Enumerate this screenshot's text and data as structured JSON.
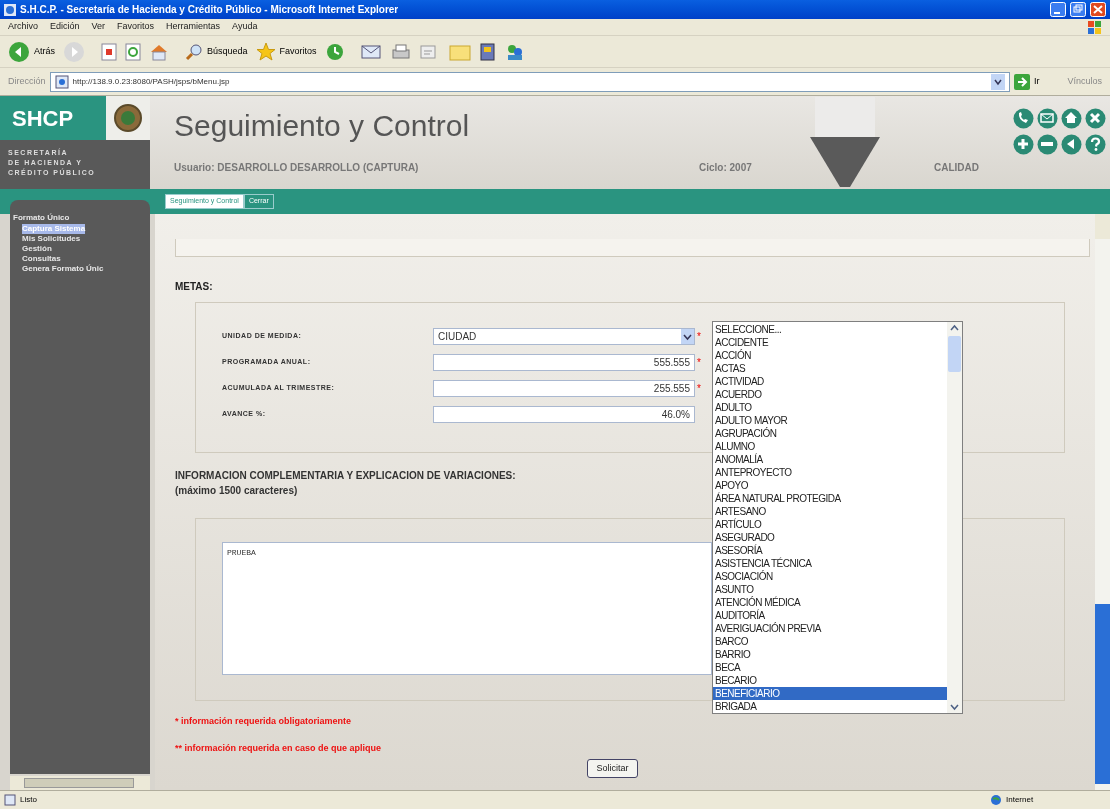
{
  "window": {
    "title": "S.H.C.P. - Secretaría de Hacienda y Crédito Público - Microsoft Internet Explorer"
  },
  "menu_bar": [
    "Archivo",
    "Edición",
    "Ver",
    "Favoritos",
    "Herramientas",
    "Ayuda"
  ],
  "toolbar": {
    "back": "Atrás",
    "search": "Búsqueda",
    "favorites": "Favoritos"
  },
  "address_bar": {
    "label": "Dirección",
    "url": "http://138.9.0.23:8080/PASH/jsps/bMenu.jsp",
    "go": "Ir",
    "links": "Vínculos"
  },
  "header": {
    "logo": "SHCP",
    "agency": [
      "SECRETARÍA",
      "DE HACIENDA Y",
      "CRÉDITO PÚBLICO"
    ],
    "title": "Seguimiento y Control",
    "user": "Usuario: DESARROLLO DESARROLLO (CAPTURA)",
    "cycle": "Ciclo: 2007",
    "area": "CALIDAD"
  },
  "tabs": [
    {
      "label": "Seguimiento y Control",
      "selected": true
    },
    {
      "label": "Cerrar",
      "selected": false
    }
  ],
  "sidebar": {
    "items": [
      {
        "label": "Formato Único",
        "selected": false,
        "children": [
          {
            "label": "Captura Sistema",
            "selected": true
          },
          {
            "label": "Mis Solicitudes",
            "selected": false
          },
          {
            "label": "Gestión",
            "selected": false
          },
          {
            "label": "Consultas",
            "selected": false
          },
          {
            "label": "Genera Formato Únic",
            "selected": false
          }
        ]
      }
    ]
  },
  "metas": {
    "heading": "METAS:",
    "fields": [
      {
        "label": "UNIDAD DE MEDIDA:",
        "kind": "select",
        "value": "CIUDAD",
        "required_mark": "*"
      },
      {
        "label": "PROGRAMADA ANUAL:",
        "kind": "text",
        "value": "555.555",
        "required_mark": "*"
      },
      {
        "label": "ACUMULADA AL TRIMESTRE:",
        "kind": "text",
        "value": "255.555",
        "required_mark": "*"
      },
      {
        "label": "AVANCE %:",
        "kind": "text",
        "value": "46.0%"
      }
    ]
  },
  "unit_list": {
    "options": [
      {
        "label": "SELECCIONE...",
        "selected": false
      },
      {
        "label": "ACCIDENTE",
        "selected": false
      },
      {
        "label": "ACCIÓN",
        "selected": false
      },
      {
        "label": "ACTAS",
        "selected": false
      },
      {
        "label": "ACTIVIDAD",
        "selected": false
      },
      {
        "label": "ACUERDO",
        "selected": false
      },
      {
        "label": "ADULTO",
        "selected": false
      },
      {
        "label": "ADULTO MAYOR",
        "selected": false
      },
      {
        "label": "AGRUPACIÓN",
        "selected": false
      },
      {
        "label": "ALUMNO",
        "selected": false
      },
      {
        "label": "ANOMALÍA",
        "selected": false
      },
      {
        "label": "ANTEPROYECTO",
        "selected": false
      },
      {
        "label": "APOYO",
        "selected": false
      },
      {
        "label": "ÁREA NATURAL PROTEGIDA",
        "selected": false
      },
      {
        "label": "ARTESANO",
        "selected": false
      },
      {
        "label": "ARTÍCULO",
        "selected": false
      },
      {
        "label": "ASEGURADO",
        "selected": false
      },
      {
        "label": "ASESORÍA",
        "selected": false
      },
      {
        "label": "ASISTENCIA TÉCNICA",
        "selected": false
      },
      {
        "label": "ASOCIACIÓN",
        "selected": false
      },
      {
        "label": "ASUNTO",
        "selected": false
      },
      {
        "label": "ATENCIÓN MÉDICA",
        "selected": false
      },
      {
        "label": "AUDITORÍA",
        "selected": false
      },
      {
        "label": "AVERIGUACIÓN PREVIA",
        "selected": false
      },
      {
        "label": "BARCO",
        "selected": false
      },
      {
        "label": "BARRIO",
        "selected": false
      },
      {
        "label": "BECA",
        "selected": false
      },
      {
        "label": "BECARIO",
        "selected": false
      },
      {
        "label": "BENEFICIARIO",
        "selected": true
      },
      {
        "label": "BRIGADA",
        "selected": false
      }
    ]
  },
  "info": {
    "heading": "INFORMACION COMPLEMENTARIA Y EXPLICACION DE VARIACIONES:",
    "note": "(máximo 1500 caracteres)",
    "text": "PRUEBA"
  },
  "notes": [
    "* información requerida obligatoriamente",
    "** información requerida en caso de que aplique"
  ],
  "submit": "Solicitar",
  "status_bar": {
    "text": "Listo",
    "zone": "Internet"
  }
}
